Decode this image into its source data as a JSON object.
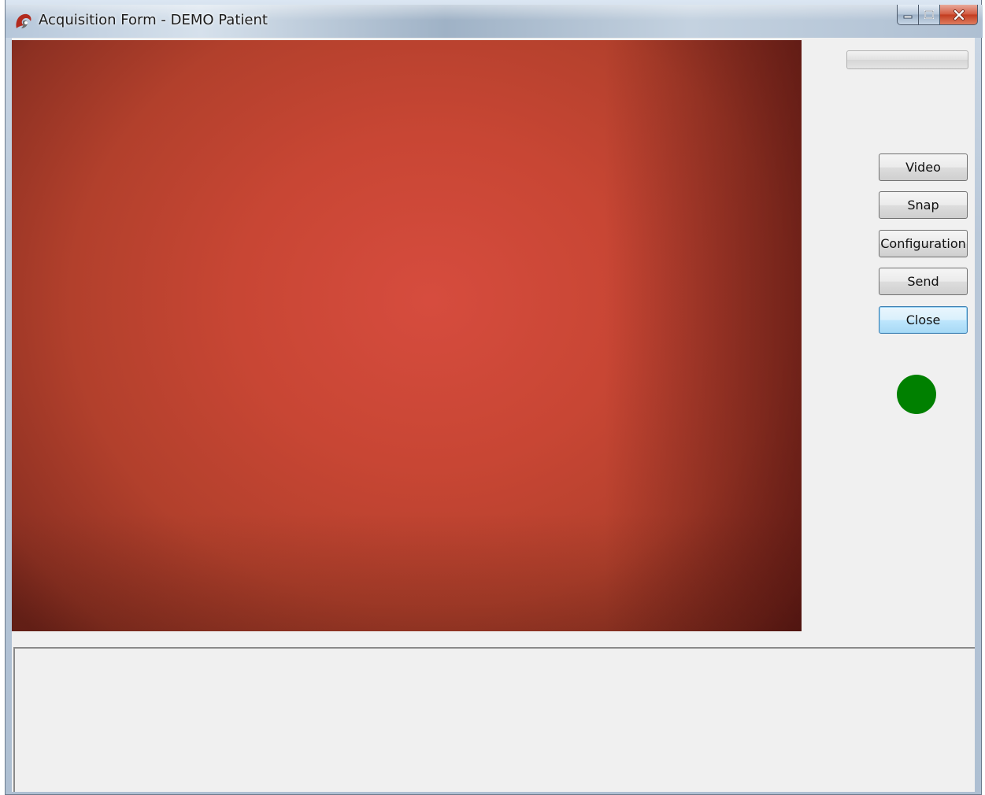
{
  "window": {
    "title": "Acquisition Form - DEMO Patient",
    "icon": "app-logo-icon",
    "caption_buttons": {
      "minimize_icon": "minimize-icon",
      "maximize_icon": "maximize-icon",
      "close_icon": "close-icon"
    }
  },
  "video": {
    "description_color": "#c84634"
  },
  "progress": {
    "value": 0
  },
  "buttons": {
    "video_label": "Video",
    "snap_label": "Snap",
    "configuration_label": "Configuration",
    "send_label": "Send",
    "close_label": "Close"
  },
  "status": {
    "indicator_color": "#008000"
  },
  "colors": {
    "accent": "#3c7fb1",
    "status_ok": "#008000",
    "window_bg": "#f0f0f0"
  }
}
